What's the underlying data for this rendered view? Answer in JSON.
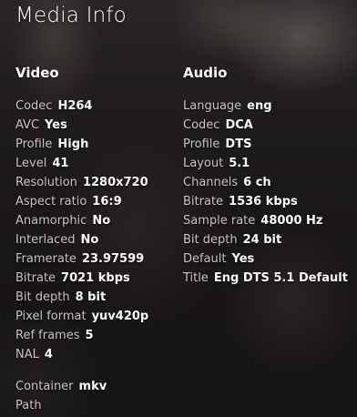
{
  "title": "Media Info",
  "video": {
    "heading": "Video",
    "rows": [
      {
        "label": "Codec",
        "value": "H264"
      },
      {
        "label": "AVC",
        "value": "Yes"
      },
      {
        "label": "Profile",
        "value": "High"
      },
      {
        "label": "Level",
        "value": "41"
      },
      {
        "label": "Resolution",
        "value": "1280x720"
      },
      {
        "label": "Aspect ratio",
        "value": "16:9"
      },
      {
        "label": "Anamorphic",
        "value": "No"
      },
      {
        "label": "Interlaced",
        "value": "No"
      },
      {
        "label": "Framerate",
        "value": "23.97599"
      },
      {
        "label": "Bitrate",
        "value": "7021 kbps"
      },
      {
        "label": "Bit depth",
        "value": "8 bit"
      },
      {
        "label": "Pixel format",
        "value": "yuv420p"
      },
      {
        "label": "Ref frames",
        "value": "5"
      },
      {
        "label": "NAL",
        "value": "4"
      }
    ]
  },
  "audio": {
    "heading": "Audio",
    "rows": [
      {
        "label": "Language",
        "value": "eng"
      },
      {
        "label": "Codec",
        "value": "DCA"
      },
      {
        "label": "Profile",
        "value": "DTS"
      },
      {
        "label": "Layout",
        "value": "5.1"
      },
      {
        "label": "Channels",
        "value": "6 ch"
      },
      {
        "label": "Bitrate",
        "value": "1536 kbps"
      },
      {
        "label": "Sample rate",
        "value": "48000 Hz"
      },
      {
        "label": "Bit depth",
        "value": "24 bit"
      },
      {
        "label": "Default",
        "value": "Yes"
      },
      {
        "label": "Title",
        "value": "Eng DTS 5.1 Default"
      }
    ]
  },
  "container": {
    "label": "Container",
    "value": "mkv"
  },
  "path": {
    "label": "Path",
    "value": ""
  }
}
